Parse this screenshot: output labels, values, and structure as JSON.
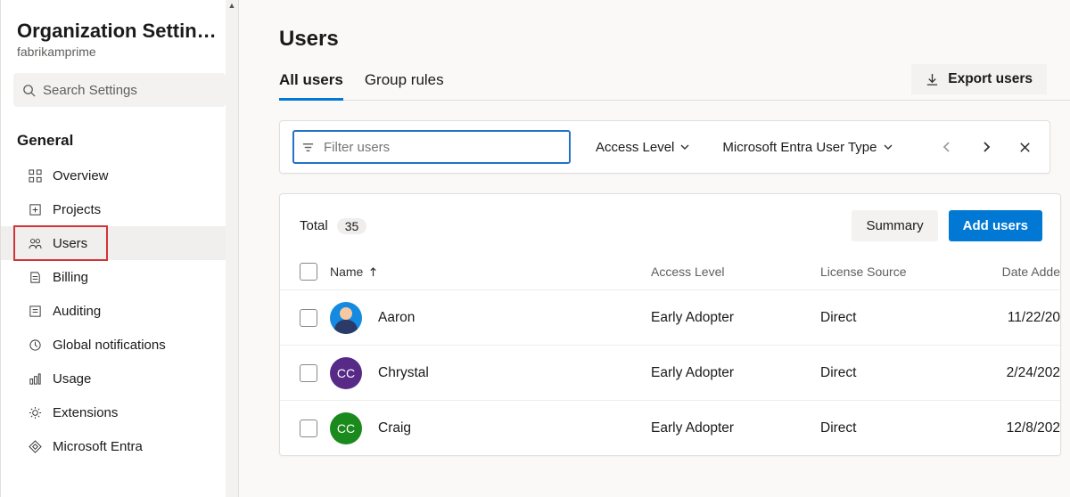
{
  "sidebar": {
    "title": "Organization Settin…",
    "subtitle": "fabrikamprime",
    "search_placeholder": "Search Settings",
    "section_label": "General",
    "items": [
      {
        "label": "Overview"
      },
      {
        "label": "Projects"
      },
      {
        "label": "Users"
      },
      {
        "label": "Billing"
      },
      {
        "label": "Auditing"
      },
      {
        "label": "Global notifications"
      },
      {
        "label": "Usage"
      },
      {
        "label": "Extensions"
      },
      {
        "label": "Microsoft Entra"
      }
    ]
  },
  "page": {
    "title": "Users",
    "tabs": {
      "all_users": "All users",
      "group_rules": "Group rules"
    },
    "export_label": "Export users"
  },
  "filters": {
    "placeholder": "Filter users",
    "access_level": "Access Level",
    "entra_type": "Microsoft Entra User Type"
  },
  "table": {
    "total_label": "Total",
    "total_count": "35",
    "summary_label": "Summary",
    "add_label": "Add users",
    "headers": {
      "name": "Name",
      "access": "Access Level",
      "source": "License Source",
      "date": "Date Adde"
    },
    "rows": [
      {
        "name": "Aaron",
        "access": "Early Adopter",
        "source": "Direct",
        "date": "11/22/20",
        "avatar_text": "",
        "avatar_class": "person"
      },
      {
        "name": "Chrystal",
        "access": "Early Adopter",
        "source": "Direct",
        "date": "2/24/202",
        "avatar_text": "CC",
        "avatar_class": "purple"
      },
      {
        "name": "Craig",
        "access": "Early Adopter",
        "source": "Direct",
        "date": "12/8/202",
        "avatar_text": "CC",
        "avatar_class": "green"
      }
    ]
  }
}
